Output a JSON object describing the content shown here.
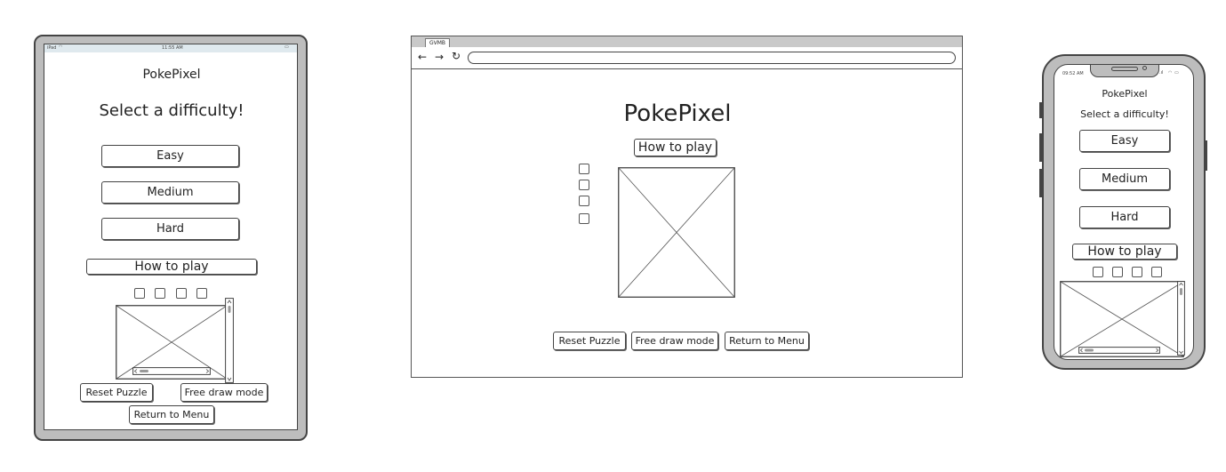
{
  "title": "PokePixel",
  "select_difficulty": "Select a difficulty!",
  "difficulties": [
    "Easy",
    "Medium",
    "Hard"
  ],
  "how_to_play": "How to play",
  "actions": {
    "reset": "Reset Puzzle",
    "free_draw": "Free draw mode",
    "return_menu": "Return to Menu"
  },
  "tablet_status": {
    "carrier": "iPad",
    "time": "11:55 AM"
  },
  "phone_status": {
    "time": "09:52 AM"
  },
  "browser": {
    "tab_label": "GVMB"
  },
  "icons": [
    "wifi-icon",
    "battery-icon",
    "back-arrow-icon",
    "forward-arrow-icon",
    "refresh-icon",
    "signal-icon",
    "image-placeholder-icon",
    "checkbox-icon",
    "scrollbar-icon"
  ]
}
